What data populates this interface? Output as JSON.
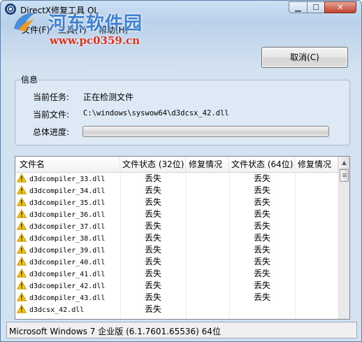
{
  "window": {
    "title": "DirectX修复工具 OL",
    "controls": {
      "minimize": "▁",
      "maximize": "☐",
      "close": "✕"
    }
  },
  "menu": [
    {
      "label": "文件(F)"
    },
    {
      "label": "工具(T)"
    },
    {
      "label": "帮助(H)"
    }
  ],
  "watermark": {
    "title": "河东软件园",
    "url": "www.pc0359.cn"
  },
  "cancel_button": "取消(C)",
  "info": {
    "legend": "信息",
    "task_label": "当前任务:",
    "task_value": "正在检测文件",
    "file_label": "当前文件:",
    "file_value": "C:\\windows\\syswow64\\d3dcsx_42.dll",
    "progress_label": "总体进度:",
    "progress": 0
  },
  "list": {
    "columns": [
      "文件名",
      "文件状态 (32位)",
      "修复情况",
      "文件状态 (64位)",
      "修复情况"
    ],
    "rows": [
      {
        "name": "d3dcompiler_33.dll",
        "status32": "丢失",
        "repair32": "",
        "status64": "丢失",
        "repair64": ""
      },
      {
        "name": "d3dcompiler_34.dll",
        "status32": "丢失",
        "repair32": "",
        "status64": "丢失",
        "repair64": ""
      },
      {
        "name": "d3dcompiler_35.dll",
        "status32": "丢失",
        "repair32": "",
        "status64": "丢失",
        "repair64": ""
      },
      {
        "name": "d3dcompiler_36.dll",
        "status32": "丢失",
        "repair32": "",
        "status64": "丢失",
        "repair64": ""
      },
      {
        "name": "d3dcompiler_37.dll",
        "status32": "丢失",
        "repair32": "",
        "status64": "丢失",
        "repair64": ""
      },
      {
        "name": "d3dcompiler_38.dll",
        "status32": "丢失",
        "repair32": "",
        "status64": "丢失",
        "repair64": ""
      },
      {
        "name": "d3dcompiler_39.dll",
        "status32": "丢失",
        "repair32": "",
        "status64": "丢失",
        "repair64": ""
      },
      {
        "name": "d3dcompiler_40.dll",
        "status32": "丢失",
        "repair32": "",
        "status64": "丢失",
        "repair64": ""
      },
      {
        "name": "d3dcompiler_41.dll",
        "status32": "丢失",
        "repair32": "",
        "status64": "丢失",
        "repair64": ""
      },
      {
        "name": "d3dcompiler_42.dll",
        "status32": "丢失",
        "repair32": "",
        "status64": "丢失",
        "repair64": ""
      },
      {
        "name": "d3dcompiler_43.dll",
        "status32": "丢失",
        "repair32": "",
        "status64": "丢失",
        "repair64": ""
      },
      {
        "name": "d3dcsx_42.dll",
        "status32": "丢失",
        "repair32": "",
        "status64": "",
        "repair64": ""
      }
    ]
  },
  "status_bar": "Microsoft Windows 7 企业版 (6.1.7601.65536) 64位",
  "icons": {
    "app": "directx-app-icon",
    "row": "warning-icon",
    "scroll": "scroll-up-arrow-icon"
  },
  "colors": {
    "warning": "#f6c400",
    "watermark_title": "#3d7fd0",
    "watermark_url": "#e0301d"
  }
}
